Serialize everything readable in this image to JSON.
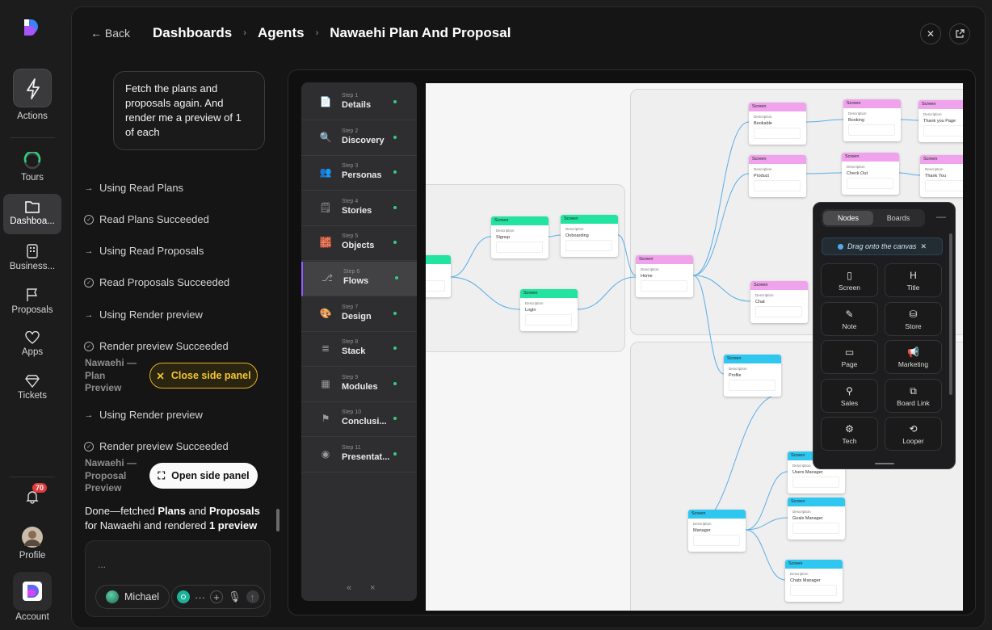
{
  "rail": {
    "actions": "Actions",
    "tours": "Tours",
    "dashboards": "Dashboa...",
    "business": "Business...",
    "proposals": "Proposals",
    "apps": "Apps",
    "tickets": "Tickets",
    "notifications_count": "70",
    "profile": "Profile",
    "account": "Account"
  },
  "header": {
    "back": "Back",
    "crumbs": [
      "Dashboards",
      "Agents",
      "Nawaehi Plan And Proposal"
    ]
  },
  "chat": {
    "prompt": "Fetch the plans and proposals again. And render me a preview of 1 of each",
    "steps": [
      "Using Read Plans",
      "Read Plans Succeeded",
      "Using Read Proposals",
      "Read Proposals Succeeded",
      "Using Render preview",
      "Render preview Succeeded",
      "Using Render preview",
      "Render preview Succeeded"
    ],
    "preview1": "Nawaehi — Plan Preview",
    "close_panel": "Close side panel",
    "preview2": "Nawaehi — Proposal Preview",
    "open_panel": "Open side panel",
    "done_parts": [
      "Done—fetched ",
      "Plans",
      " and ",
      "Proposals",
      " for Nawaehi and rendered ",
      "1 preview"
    ],
    "composer_placeholder": "...",
    "user": "Michael"
  },
  "wizard": {
    "steps": [
      {
        "num": "Step 1",
        "label": "Details"
      },
      {
        "num": "Step 2",
        "label": "Discovery"
      },
      {
        "num": "Step 3",
        "label": "Personas"
      },
      {
        "num": "Step 4",
        "label": "Stories"
      },
      {
        "num": "Step 5",
        "label": "Objects"
      },
      {
        "num": "Step 6",
        "label": "Flows"
      },
      {
        "num": "Step 7",
        "label": "Design"
      },
      {
        "num": "Step 8",
        "label": "Stack"
      },
      {
        "num": "Step 9",
        "label": "Modules"
      },
      {
        "num": "Step 10",
        "label": "Conclusi..."
      },
      {
        "num": "Step 11",
        "label": "Presentat..."
      }
    ],
    "active_index": 5
  },
  "canvas": {
    "node_type": "Screen",
    "desc_label": "Description",
    "nodes": [
      "Bookable",
      "Booking",
      "Thank you Page",
      "Product",
      "Check Out",
      "Thank You",
      "Signup",
      "Onboarding",
      "Home",
      "Login",
      "Chat",
      "Profile",
      "Users Manager",
      "Goals Manager",
      "Manager",
      "Chats Manager"
    ]
  },
  "palette": {
    "tabs": [
      "Nodes",
      "Boards"
    ],
    "hint": "Drag onto the canvas",
    "items": [
      {
        "label": "Screen",
        "icon": "phone-icon"
      },
      {
        "label": "Title",
        "icon": "heading-icon"
      },
      {
        "label": "Note",
        "icon": "pen-icon"
      },
      {
        "label": "Store",
        "icon": "database-icon"
      },
      {
        "label": "Page",
        "icon": "window-icon"
      },
      {
        "label": "Marketing",
        "icon": "megaphone-icon"
      },
      {
        "label": "Sales",
        "icon": "person-icon"
      },
      {
        "label": "Board Link",
        "icon": "link-icon"
      },
      {
        "label": "Tech",
        "icon": "gear-icon"
      },
      {
        "label": "Looper",
        "icon": "loop-icon"
      }
    ]
  },
  "colors": {
    "green": "#22e3a0",
    "pink": "#f0a3ec",
    "blue": "#2fc6f0",
    "accent": "#f5c531"
  }
}
